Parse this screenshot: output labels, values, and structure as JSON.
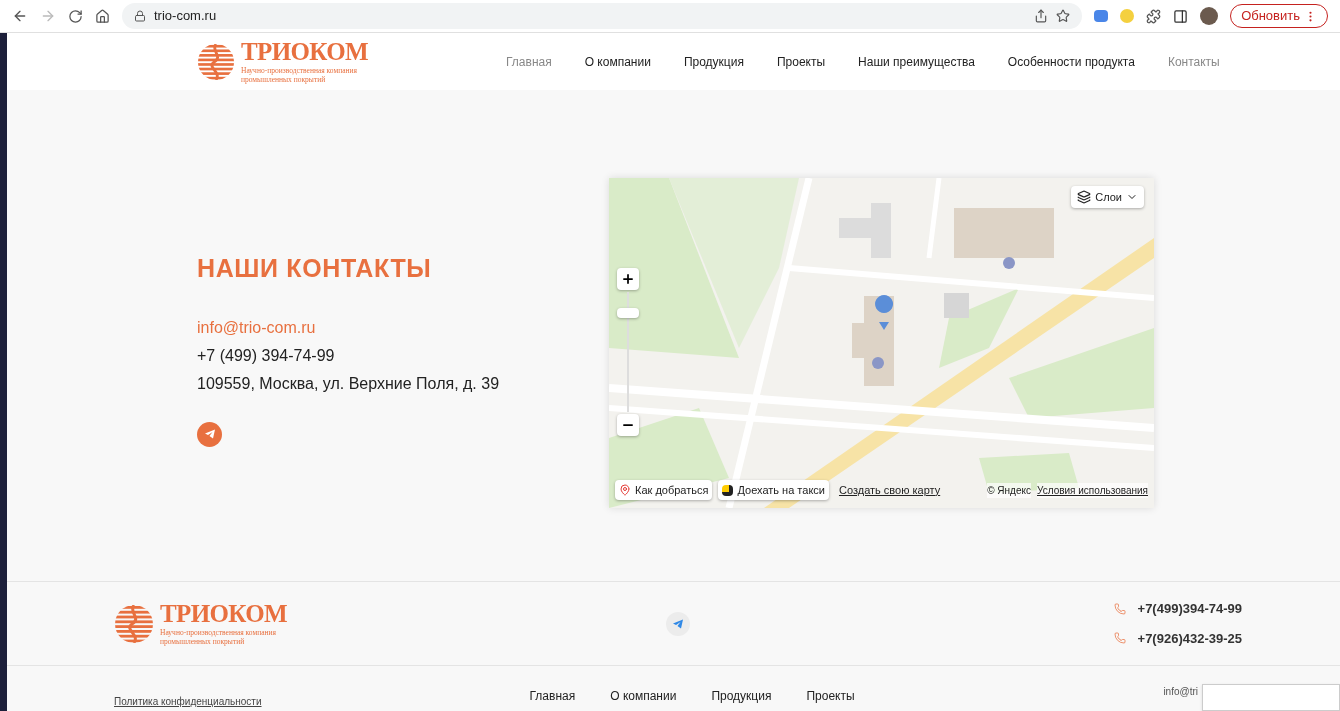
{
  "browser": {
    "url": "trio-com.ru",
    "update_button": "Обновить"
  },
  "header": {
    "logo": {
      "name": "ТРИОКОМ",
      "tagline_1": "Научно-производственная компания",
      "tagline_2": "промышленных покрытий"
    },
    "nav": [
      {
        "label": "Главная",
        "dimmed": true
      },
      {
        "label": "О компании",
        "dimmed": false
      },
      {
        "label": "Продукция",
        "dimmed": false
      },
      {
        "label": "Проекты",
        "dimmed": false
      },
      {
        "label": "Наши преимущества",
        "dimmed": false
      },
      {
        "label": "Особенности продукта",
        "dimmed": false
      },
      {
        "label": "Контакты",
        "dimmed": true
      }
    ]
  },
  "contacts": {
    "title": "НАШИ КОНТАКТЫ",
    "email": "info@trio-com.ru",
    "phone": "+7 (499) 394-74-99",
    "address": "109559, Москва, ул. Верхние Поля, д. 39"
  },
  "map": {
    "layers_label": "Слои",
    "route_button": "Как добраться",
    "taxi_button": "Доехать на такси",
    "create_link": "Создать свою карту",
    "copyright": "© Яндекс",
    "terms_link": "Условия использования"
  },
  "footer": {
    "logo": {
      "name": "ТРИОКОМ",
      "tagline_1": "Научно-производственная компания",
      "tagline_2": "промышленных покрытий"
    },
    "phones": [
      "+7(499)394-74-99",
      "+7(926)432-39-25"
    ],
    "privacy_link": "Политика конфиденциальности",
    "nav": [
      "Главная",
      "О компании",
      "Продукция",
      "Проекты"
    ],
    "email_partial": "info@tri"
  }
}
